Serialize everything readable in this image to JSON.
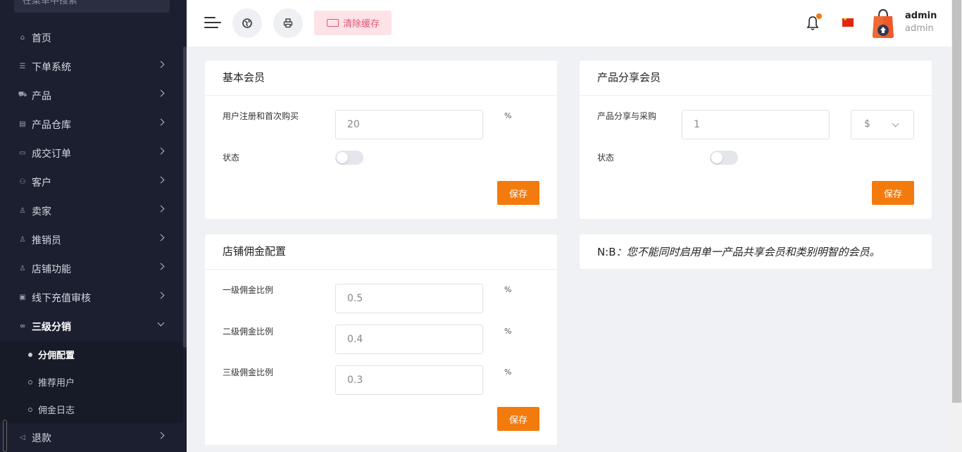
{
  "sidebar": {
    "search_placeholder": "在菜单中搜索",
    "items": [
      {
        "label": "首页",
        "icon": "home-icon",
        "has_children": false
      },
      {
        "label": "下单系统",
        "icon": "list-icon",
        "has_children": true
      },
      {
        "label": "产品",
        "icon": "cart-icon",
        "has_children": true
      },
      {
        "label": "产品仓库",
        "icon": "warehouse-icon",
        "has_children": true
      },
      {
        "label": "成交订单",
        "icon": "order-icon",
        "has_children": true
      },
      {
        "label": "客户",
        "icon": "users-icon",
        "has_children": true
      },
      {
        "label": "卖家",
        "icon": "user-icon",
        "has_children": true
      },
      {
        "label": "推销员",
        "icon": "user-icon",
        "has_children": true
      },
      {
        "label": "店铺功能",
        "icon": "user-icon",
        "has_children": true
      },
      {
        "label": "线下充值审核",
        "icon": "cash-icon",
        "has_children": true
      },
      {
        "label": "三级分销",
        "icon": "link-icon",
        "has_children": true,
        "expanded": true
      },
      {
        "label": "退款",
        "icon": "refund-icon",
        "has_children": true
      }
    ],
    "submenu": [
      {
        "label": "分佣配置",
        "active": true
      },
      {
        "label": "推荐用户",
        "active": false
      },
      {
        "label": "佣金日志",
        "active": false
      }
    ]
  },
  "header": {
    "clear_cache_label": "清除缓存",
    "user_name": "admin",
    "user_role": "admin",
    "accent_color": "#f37b0d"
  },
  "basic_member": {
    "title": "基本会员",
    "field_label": "用户注册和首次购买",
    "field_value": "20",
    "unit": "%",
    "status_label": "状态",
    "status_on": false,
    "save_label": "保存"
  },
  "product_share": {
    "title": "产品分享会员",
    "field_label": "产品分享与采购",
    "field_value": "1",
    "currency": "$",
    "status_label": "状态",
    "status_on": false,
    "save_label": "保存"
  },
  "store_commission": {
    "title": "店铺佣金配置",
    "rows": [
      {
        "label": "一级佣金比例",
        "value": "0.5",
        "unit": "%"
      },
      {
        "label": "二级佣金比例",
        "value": "0.4",
        "unit": "%"
      },
      {
        "label": "三级佣金比例",
        "value": "0.3",
        "unit": "%"
      }
    ],
    "save_label": "保存"
  },
  "note": {
    "prefix": "N:B",
    "text": "：您不能同时启用单一产品共享会员和类别明智的会员。"
  }
}
